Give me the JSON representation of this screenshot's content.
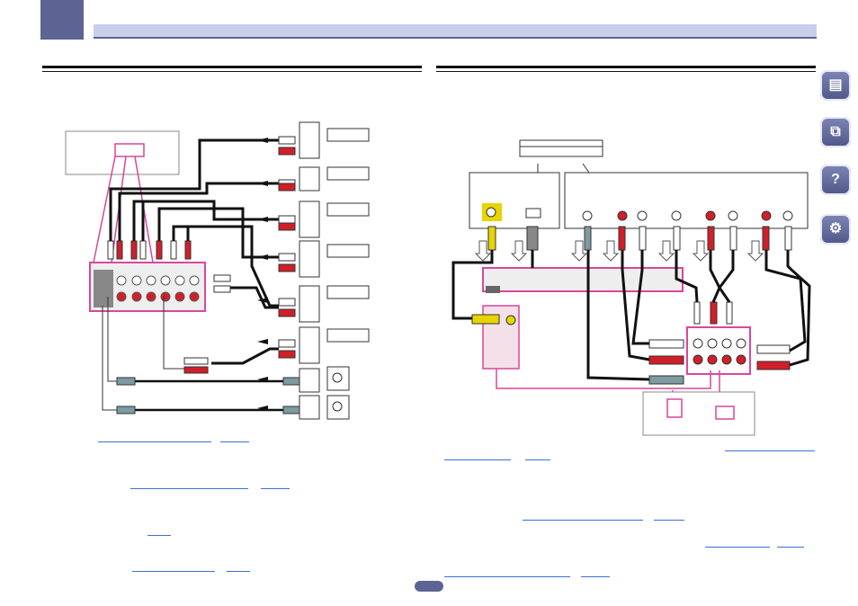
{
  "nav_icons": [
    {
      "name": "manual-book-icon",
      "glyph": "▤"
    },
    {
      "name": "connection-icon",
      "glyph": "⧉"
    },
    {
      "name": "help-icon",
      "glyph": "?"
    },
    {
      "name": "tools-icon",
      "glyph": "⚙"
    }
  ],
  "colors": {
    "accent": "#5c6494",
    "accent_light": "#c9ceea",
    "magenta": "#d9479a",
    "red_plug": "#d11f2a",
    "yellow_plug": "#e8d400",
    "link": "#3a6fd8"
  }
}
